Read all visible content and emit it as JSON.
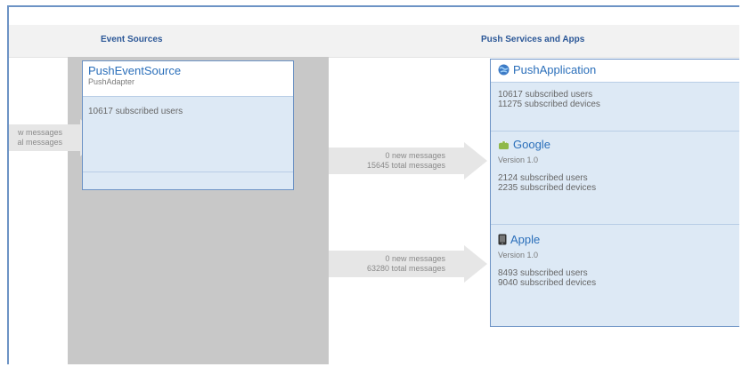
{
  "headers": {
    "event_sources": "Event Sources",
    "push_services": "Push Services and Apps"
  },
  "left_arrow": {
    "line1": "w messages",
    "line2": "al messages"
  },
  "event_source": {
    "title": "PushEventSource",
    "subtitle": "PushAdapter",
    "users": "10617 subscribed users"
  },
  "arrow_google": {
    "new": "0 new messages",
    "total": "15645 total messages"
  },
  "arrow_apple": {
    "new": "0 new messages",
    "total": "63280 total messages"
  },
  "push_app": {
    "title": "PushApplication",
    "icon": "globe-icon",
    "users": "10617 subscribed users",
    "devices": "11275 subscribed devices"
  },
  "google": {
    "title": "Google",
    "icon": "android-icon",
    "version": "Version 1.0",
    "users": "2124 subscribed users",
    "devices": "2235 subscribed devices"
  },
  "apple": {
    "title": "Apple",
    "icon": "phone-icon",
    "version": "Version 1.0",
    "users": "8493 subscribed users",
    "devices": "9040 subscribed devices"
  },
  "colors": {
    "accent": "#2b6fba",
    "card_bg": "#dde9f5",
    "border": "#6d93c5",
    "gray_column": "#c8c8c8"
  }
}
